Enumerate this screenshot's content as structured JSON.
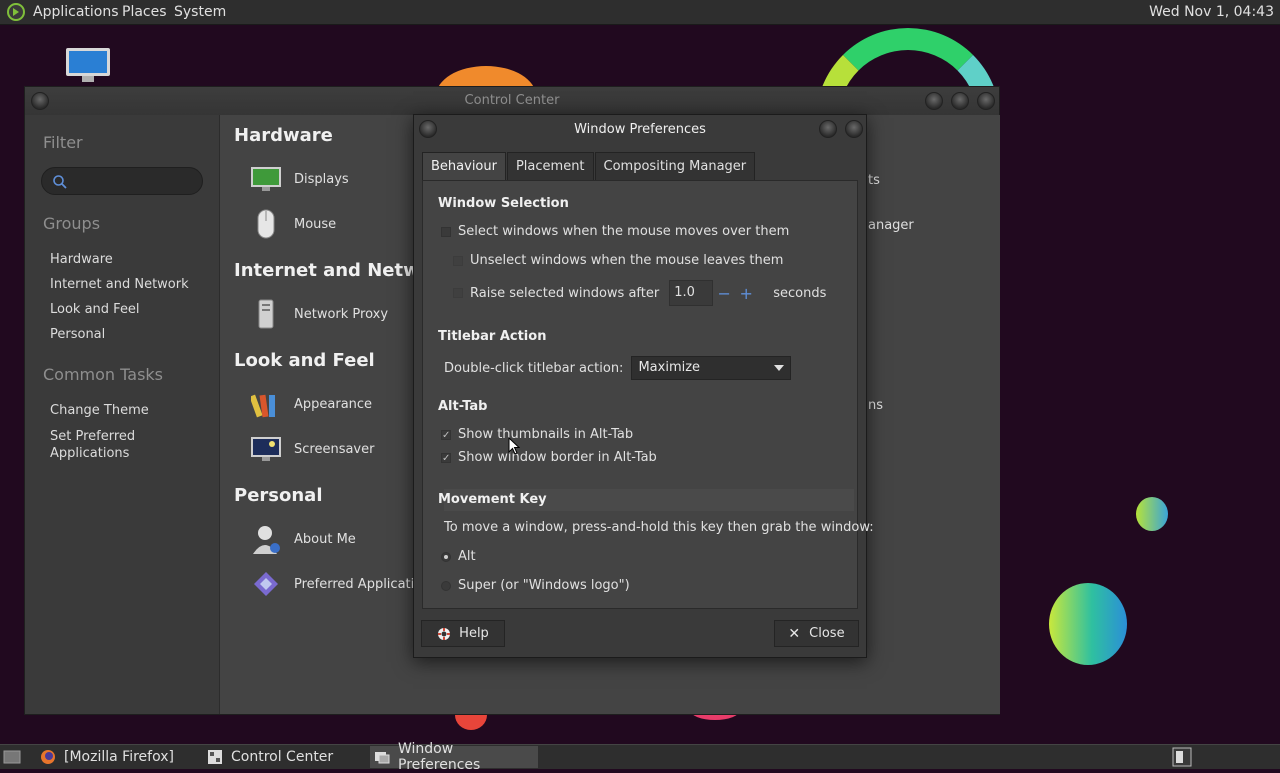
{
  "top_panel": {
    "menus": [
      "Applications",
      "Places",
      "System"
    ],
    "clock": "Wed Nov 1, 04:43"
  },
  "control_center": {
    "title": "Control Center",
    "sidebar": {
      "filter_label": "Filter",
      "groups_label": "Groups",
      "groups": [
        "Hardware",
        "Internet and Network",
        "Look and Feel",
        "Personal"
      ],
      "tasks_label": "Common Tasks",
      "tasks": [
        "Change Theme",
        "Set Preferred\nApplications"
      ]
    },
    "categories": [
      {
        "title": "Hardware",
        "items": [
          "Displays",
          "Mouse"
        ]
      },
      {
        "title": "Internet and Network",
        "items": [
          "Network Proxy"
        ]
      },
      {
        "title": "Look and Feel",
        "items": [
          "Appearance",
          "Screensaver"
        ]
      },
      {
        "title": "Personal",
        "items": [
          "About Me",
          "Preferred Applications"
        ]
      }
    ],
    "partial_right": [
      "ts",
      "anager",
      "ns"
    ]
  },
  "window_prefs": {
    "title": "Window Preferences",
    "tabs": [
      "Behaviour",
      "Placement",
      "Compositing Manager"
    ],
    "window_selection": {
      "heading": "Window Selection",
      "select_on_hover": "Select windows when the mouse moves over them",
      "unselect_on_leave": "Unselect windows when the mouse leaves them",
      "raise_after": "Raise selected windows after",
      "raise_value": "1.0",
      "seconds": "seconds"
    },
    "titlebar": {
      "heading": "Titlebar Action",
      "label": "Double-click titlebar action:",
      "value": "Maximize"
    },
    "alt_tab": {
      "heading": "Alt-Tab",
      "show_thumbnails": "Show thumbnails in Alt-Tab",
      "show_border": "Show window border in Alt-Tab"
    },
    "movement_key": {
      "heading": "Movement Key",
      "desc": "To move a window, press-and-hold this key then grab the window:",
      "alt": "Alt",
      "super": "Super (or \"Windows logo\")"
    },
    "help_label": "Help",
    "close_label": "Close"
  },
  "taskbar": {
    "tasks": [
      "[Mozilla Firefox]",
      "Control Center",
      "Window Preferences"
    ]
  }
}
